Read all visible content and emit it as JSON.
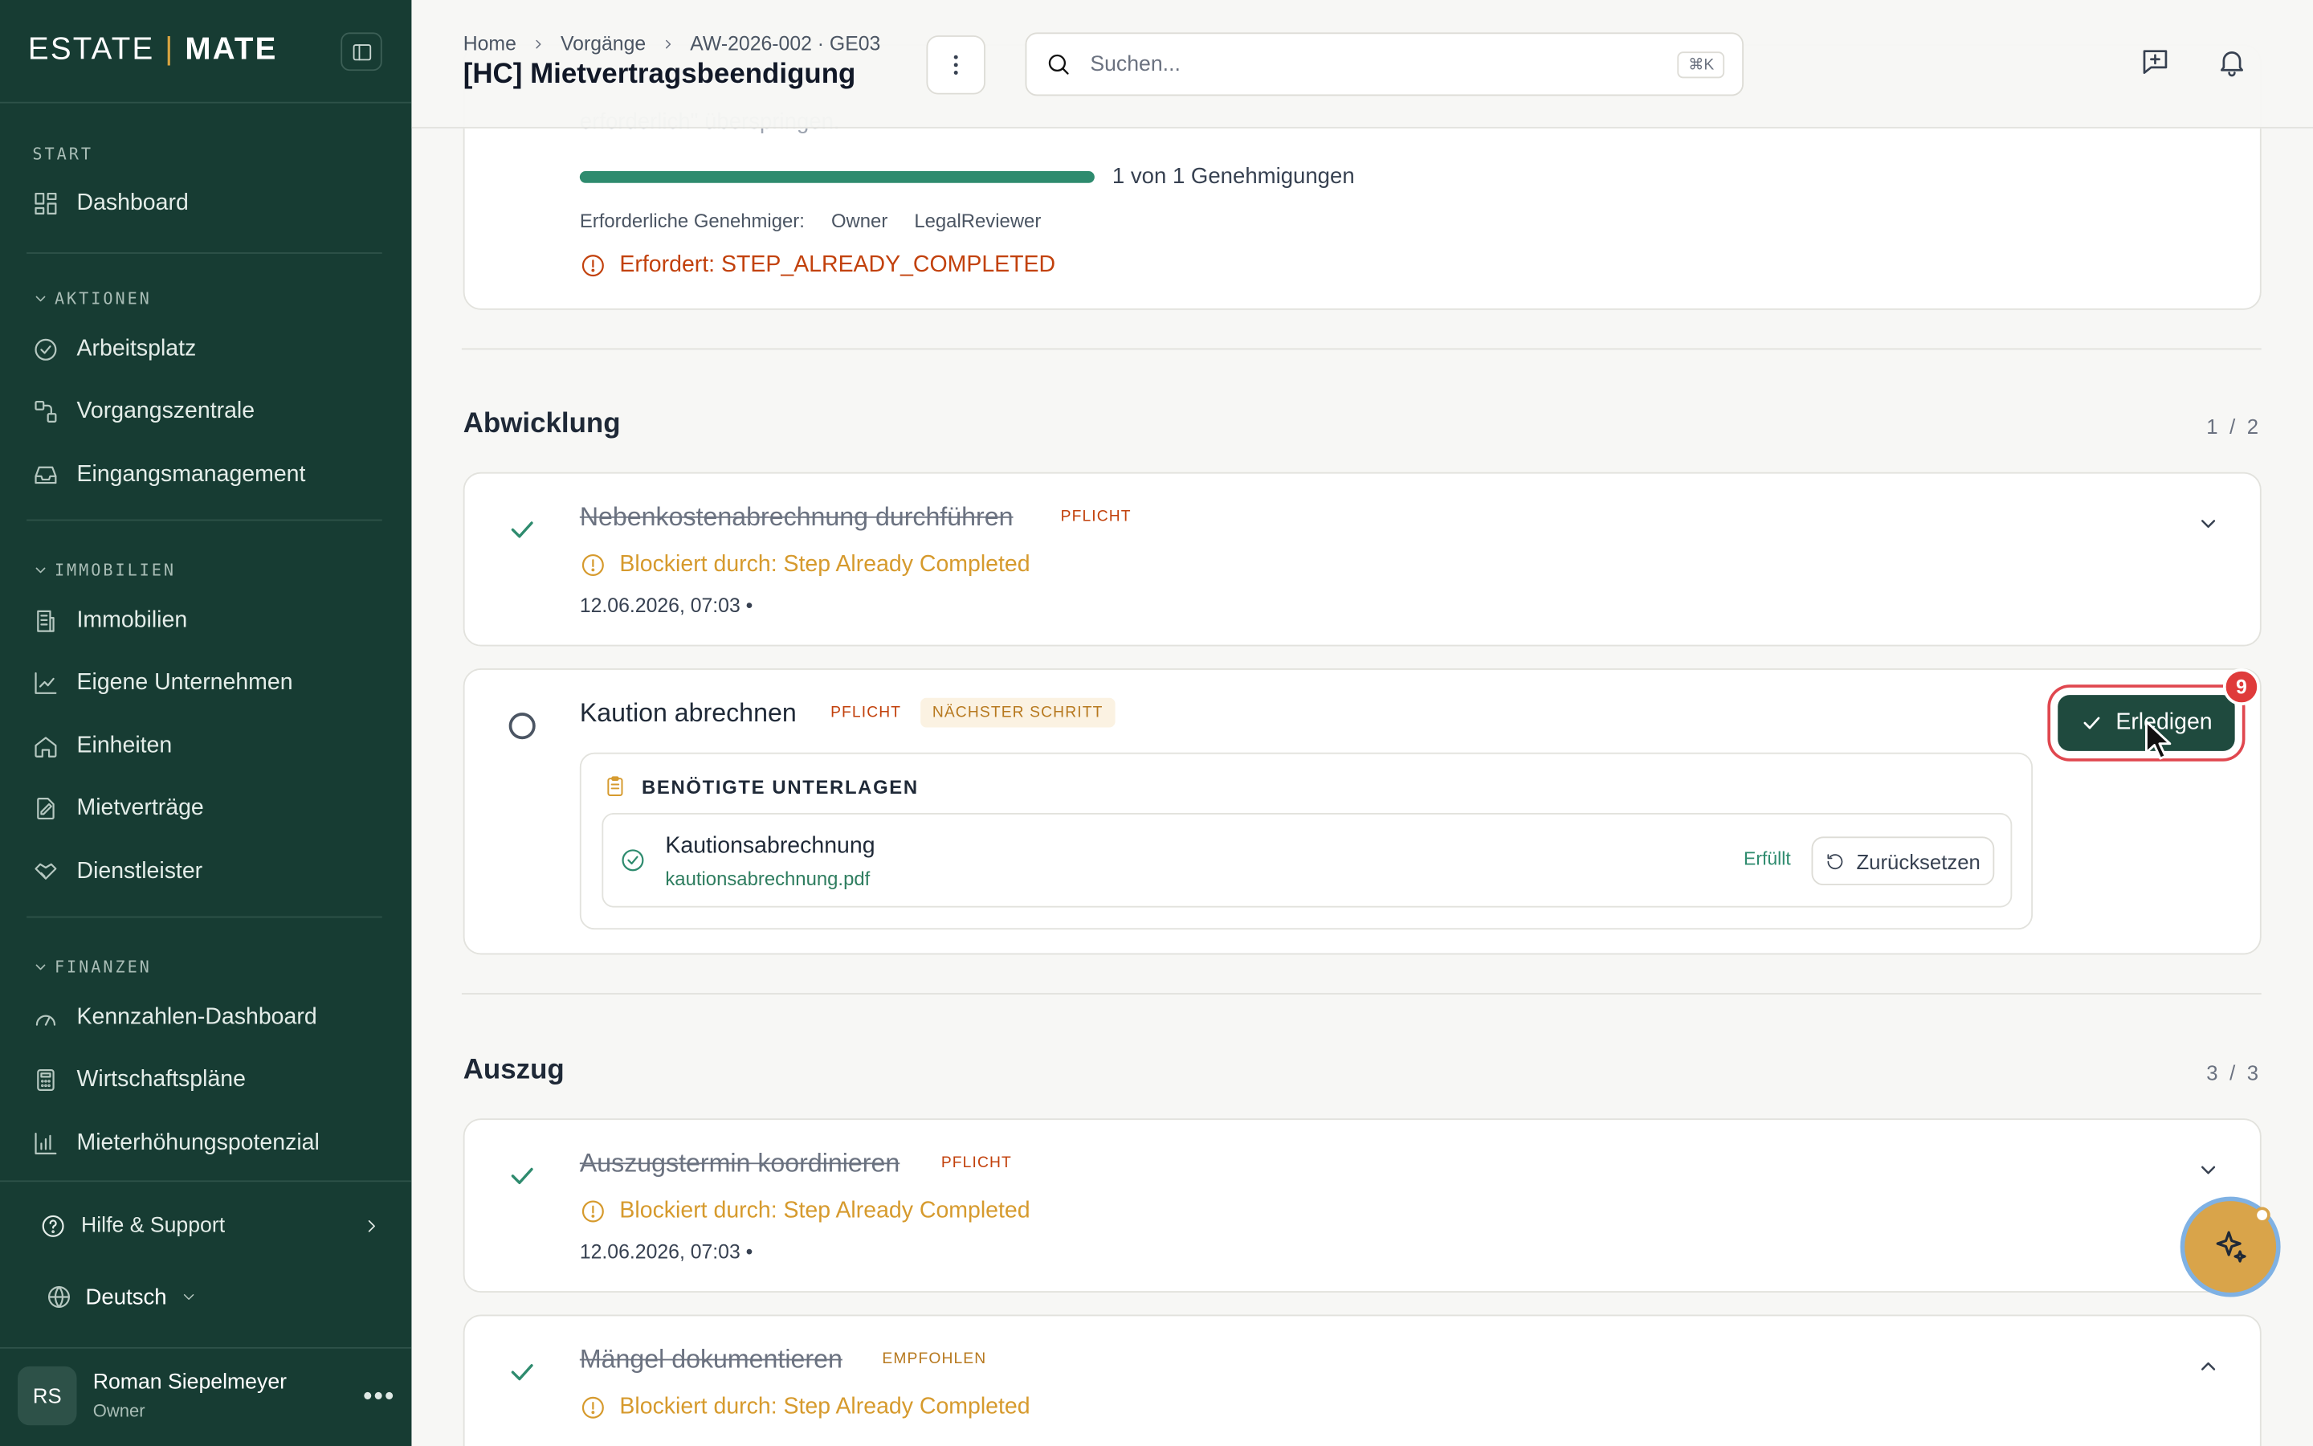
{
  "brand": {
    "left": "ESTATE",
    "sep": "|",
    "right": "MATE"
  },
  "sidebar": {
    "start_label": "START",
    "dashboard": "Dashboard",
    "aktionen_label": "AKTIONEN",
    "aktionen": [
      "Arbeitsplatz",
      "Vorgangszentrale",
      "Eingangsmanagement"
    ],
    "immobilien_label": "IMMOBILIEN",
    "immobilien": [
      "Immobilien",
      "Eigene Unternehmen",
      "Einheiten",
      "Mietverträge",
      "Dienstleister"
    ],
    "finanzen_label": "FINANZEN",
    "finanzen": [
      "Kennzahlen-Dashboard",
      "Wirtschaftspläne",
      "Mieterhöhungspotenzial"
    ],
    "help": "Hilfe & Support",
    "language": "Deutsch",
    "user": {
      "initials": "RS",
      "name": "Roman Siepelmeyer",
      "role": "Owner"
    }
  },
  "header": {
    "breadcrumbs": [
      "Home",
      "Vorgänge",
      "AW-2026-002 · GE03"
    ],
    "title": "[HC] Mietvertragsbeendigung",
    "search_placeholder": "Suchen...",
    "search_shortcut": "⌘K"
  },
  "approval": {
    "ghost_text": "erforderlich\" überspringen.",
    "progress_fraction": 1.0,
    "progress_text": "1 von 1 Genehmigungen",
    "approvers_label": "Erforderliche Genehmiger:",
    "approvers": [
      "Owner",
      "LegalReviewer"
    ],
    "error": "Erfordert: STEP_ALREADY_COMPLETED"
  },
  "abwicklung": {
    "title": "Abwicklung",
    "counter": "1 / 2",
    "step1": {
      "title": "Nebenkostenabrechnung durchführen",
      "badge": "PFLICHT",
      "warning": "Blockiert durch: Step Already Completed",
      "meta": "12.06.2026, 07:03  •"
    },
    "step2": {
      "title": "Kaution abrechnen",
      "badge": "PFLICHT",
      "badge2": "NÄCHSTER SCHRITT",
      "action": "Erledigen",
      "notifications": "9",
      "docs_title": "BENÖTIGTE UNTERLAGEN",
      "doc": {
        "name": "Kautionsabrechnung",
        "file": "kautionsabrechnung.pdf",
        "status": "Erfüllt",
        "reset": "Zurücksetzen"
      }
    }
  },
  "auszug": {
    "title": "Auszug",
    "counter": "3 / 3",
    "step1": {
      "title": "Auszugstermin koordinieren",
      "badge": "PFLICHT",
      "warning": "Blockiert durch: Step Already Completed",
      "meta": "12.06.2026, 07:03  •"
    },
    "step2": {
      "title": "Mängel dokumentieren",
      "badge": "EMPFOHLEN",
      "warning": "Blockiert durch: Step Already Completed"
    }
  },
  "colors": {
    "sidebar_bg": "#173c33",
    "accent_green": "#2e8b6e",
    "primary_button": "#1f4a3e",
    "warning": "#d69a2d",
    "error": "#c2410c",
    "ai_button": "#d9a44a"
  },
  "icons": [
    "sidebar-toggle-icon",
    "dashboard-icon",
    "check-circle-icon",
    "workflow-icon",
    "inbox-icon",
    "building-icon",
    "chart-icon",
    "home-icon",
    "contract-icon",
    "handshake-icon",
    "gauge-icon",
    "calculator-icon",
    "bar-chart-icon",
    "help-icon",
    "globe-icon",
    "search-icon",
    "feedback-icon",
    "bell-icon",
    "sparkle-icon"
  ]
}
